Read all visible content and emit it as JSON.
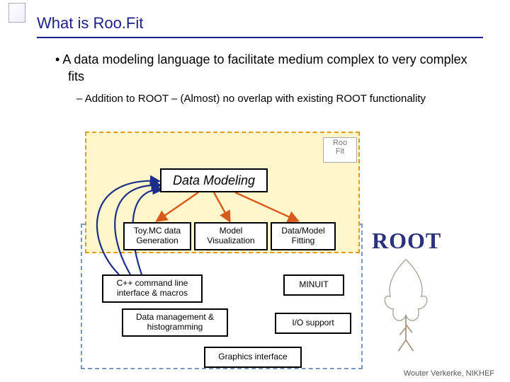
{
  "slide": {
    "title": "What is Roo.Fit",
    "bullet_main": "A data modeling language to facilitate medium complex to very complex fits",
    "bullet_sub": "Addition to ROOT – (Almost) no overlap with existing ROOT functionality"
  },
  "diagram": {
    "region_roofit_label": "Roo\nFit",
    "region_root_label": "ROOT",
    "boxes": {
      "data_modeling": "Data Modeling",
      "toy_mc": "Toy.MC data Generation",
      "model_viz": "Model Visualization",
      "data_model_fit": "Data/Model Fitting",
      "cpp_cmdline": "C++ command line interface & macros",
      "minuit": "MINUIT",
      "histogramming": "Data management & histogramming",
      "io_support": "I/O support",
      "graphics_iface": "Graphics interface"
    },
    "arrows": [
      {
        "from": "data_modeling",
        "to": "toy_mc",
        "style": "red"
      },
      {
        "from": "data_modeling",
        "to": "model_viz",
        "style": "red"
      },
      {
        "from": "data_modeling",
        "to": "data_model_fit",
        "style": "red"
      },
      {
        "from": "cpp_cmdline",
        "to": "toy_mc",
        "style": "blue-curve"
      },
      {
        "from": "cpp_cmdline",
        "to": "model_viz",
        "style": "blue-curve"
      },
      {
        "from": "cpp_cmdline",
        "to": "data_model_fit",
        "style": "blue-curve"
      }
    ]
  },
  "footer": "Wouter Verkerke, NIKHEF"
}
